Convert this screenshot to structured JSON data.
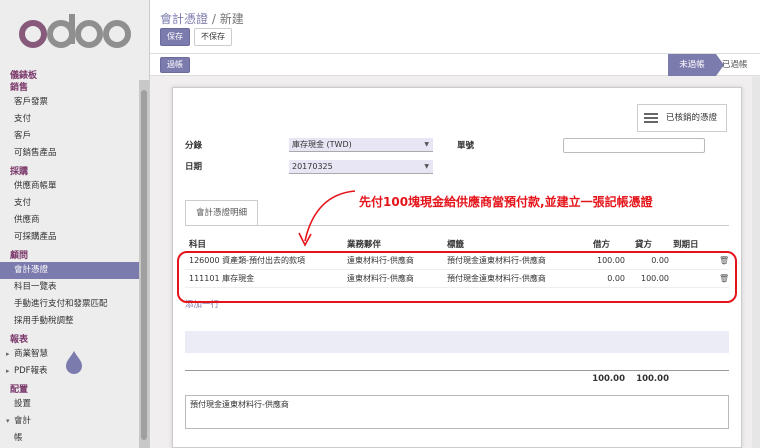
{
  "sidebar": {
    "logo_text": "odoo",
    "sections": [
      {
        "title": "儀錶板",
        "items": []
      },
      {
        "title": "銷售",
        "items": [
          "客戶發票",
          "支付",
          "客戶",
          "可銷售產品"
        ]
      },
      {
        "title": "採購",
        "items": [
          "供應商帳單",
          "支付",
          "供應商",
          "可採購產品"
        ]
      },
      {
        "title": "顧問",
        "items": [
          "會計憑證",
          "科目一覽表",
          "手動進行支付和發票匹配",
          "採用手動稅調整"
        ]
      },
      {
        "title": "報表",
        "items": [
          "商業智慧",
          "PDF報表"
        ]
      },
      {
        "title": "配置",
        "items": [
          "設置",
          "會計",
          "帳"
        ]
      }
    ]
  },
  "header": {
    "breadcrumb_parent": "會計憑證",
    "breadcrumb_sep": "/",
    "breadcrumb_current": "新建",
    "save_label": "保存",
    "discard_label": "不保存"
  },
  "statusbar": {
    "post_label": "過帳",
    "stage_unposted": "未過帳",
    "stage_posted": "已過帳"
  },
  "form": {
    "reconciled_label": "已核銷的憑證",
    "journal_label": "分錄",
    "journal_value": "庫存現金 (TWD)",
    "date_label": "日期",
    "date_value": "20170325",
    "ref_label": "單號",
    "tab_label": "會計憑證明細",
    "columns": {
      "account": "科目",
      "partner": "業務夥伴",
      "label": "標籤",
      "debit": "借方",
      "credit": "貸方",
      "maturity": "到期日"
    },
    "lines": [
      {
        "account": "126000 資產類-預付出去的款項",
        "partner": "遠東材料行-供應商",
        "label": "預付現金遠東材料行-供應商",
        "debit": "100.00",
        "credit": "0.00"
      },
      {
        "account": "111101 庫存現金",
        "partner": "遠東材料行-供應商",
        "label": "預付現金遠東材料行-供應商",
        "debit": "0.00",
        "credit": "100.00"
      }
    ],
    "add_line": "添加一行",
    "total_debit": "100.00",
    "total_credit": "100.00",
    "narration": "預付現金遠東材料行-供應商"
  },
  "annotation": {
    "text": "先付100塊現金給供應商當預付款,並建立一張記帳憑證",
    "color": "#e5141b"
  },
  "colors": {
    "accent": "#7c7bad",
    "brand": "#875a7b"
  }
}
